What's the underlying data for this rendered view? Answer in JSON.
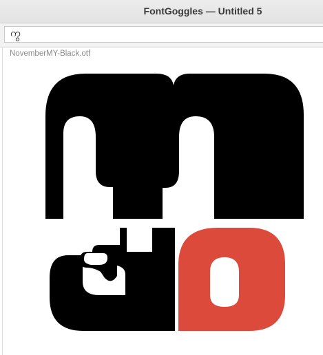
{
  "window": {
    "title": "FontGoggles — Untitled 5"
  },
  "toolbar": {
    "text_value": "ကွ"
  },
  "preview": {
    "font_label": "NovemberMY-Black.otf",
    "glyph_colors": {
      "base": "#000000",
      "highlight": "#dc4a3b",
      "background": "#ffffff"
    }
  }
}
